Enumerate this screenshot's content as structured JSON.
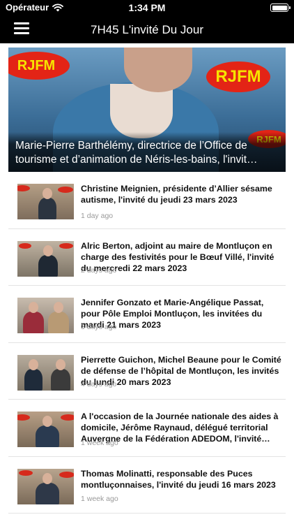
{
  "status_bar": {
    "carrier": "Opérateur",
    "time": "1:34 PM",
    "wifi_icon": "wifi-icon",
    "battery_icon": "battery-icon",
    "battery_level": 1.0
  },
  "nav": {
    "menu_icon": "hamburger-menu-icon",
    "title": "7H45 L'invité Du Jour"
  },
  "colors": {
    "bar_background": "#000000",
    "brand_red": "#e32416",
    "brand_yellow": "#f6e400",
    "time_text": "#9a9a9a"
  },
  "hero": {
    "brand_text": "RJFM",
    "caption": "Marie-Pierre Barthélémy, directrice de l’Office de tourisme et d’animation de Néris-les-bains, l'invit…"
  },
  "articles": [
    {
      "title": "Christine Meignien, présidente d’Allier sésame autisme, l'invité du jeudi 23 mars 2023",
      "time": "1 day ago"
    },
    {
      "title": "Alric Berton, adjoint au maire de Montluçon en charge des festivités pour le Bœuf Villé, l'invité du mercredi 22 mars 2023",
      "time": "2 days ago"
    },
    {
      "title": "Jennifer Gonzato et Marie-Angélique Passat, pour Pôle Emploi Montluçon, les invitées du mardi 21 mars 2023",
      "time": "3 days ago"
    },
    {
      "title": "Pierrette Guichon, Michel Beaune pour le Comité de défense de l’hôpital de Montluçon, les invités du lundi 20 mars 2023",
      "time": "4 days ago"
    },
    {
      "title": "A l'occasion de la Journée nationale des aides à domicile, Jérôme Raynaud, délégué territorial Auvergne de la Fédération ADEDOM, l'invité…",
      "time": "1 week ago"
    },
    {
      "title": "Thomas Molinatti, responsable des Puces montluçonnaises, l'invité du jeudi 16 mars 2023",
      "time": "1 week ago"
    }
  ]
}
